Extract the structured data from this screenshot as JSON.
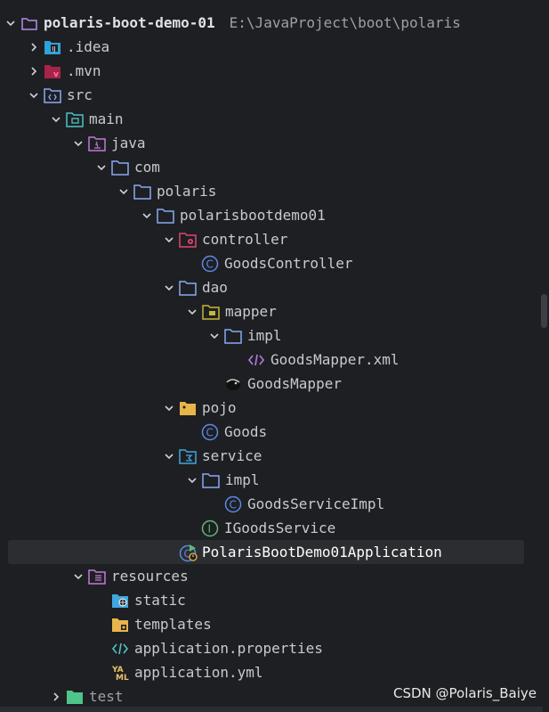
{
  "project": {
    "name": "polaris-boot-demo-01",
    "path": "E:\\JavaProject\\boot\\polaris"
  },
  "tree": {
    "idea": ".idea",
    "mvn": ".mvn",
    "src": "src",
    "main": "main",
    "java": "java",
    "com": "com",
    "polaris": "polaris",
    "polarisbootdemo01": "polarisbootdemo01",
    "controller": "controller",
    "goods_controller": "GoodsController",
    "dao": "dao",
    "mapper": "mapper",
    "impl": "impl",
    "goods_mapper_xml": "GoodsMapper.xml",
    "goods_mapper": "GoodsMapper",
    "pojo": "pojo",
    "goods": "Goods",
    "service": "service",
    "service_impl": "impl",
    "goods_service_impl": "GoodsServiceImpl",
    "igoods_service": "IGoodsService",
    "application_class": "PolarisBootDemo01Application",
    "resources": "resources",
    "static": "static",
    "templates": "templates",
    "application_properties": "application.properties",
    "application_yml": "application.yml",
    "test": "test"
  },
  "watermark": "CSDN @Polaris_Baiye",
  "colors": {
    "background": "#1e1f22",
    "selection": "#2b2d30",
    "folder": "#8aa9f5",
    "class": "#5c8ae6",
    "interface": "#5fb878",
    "controller": "#e0466f",
    "mvn": "#c2325b"
  }
}
